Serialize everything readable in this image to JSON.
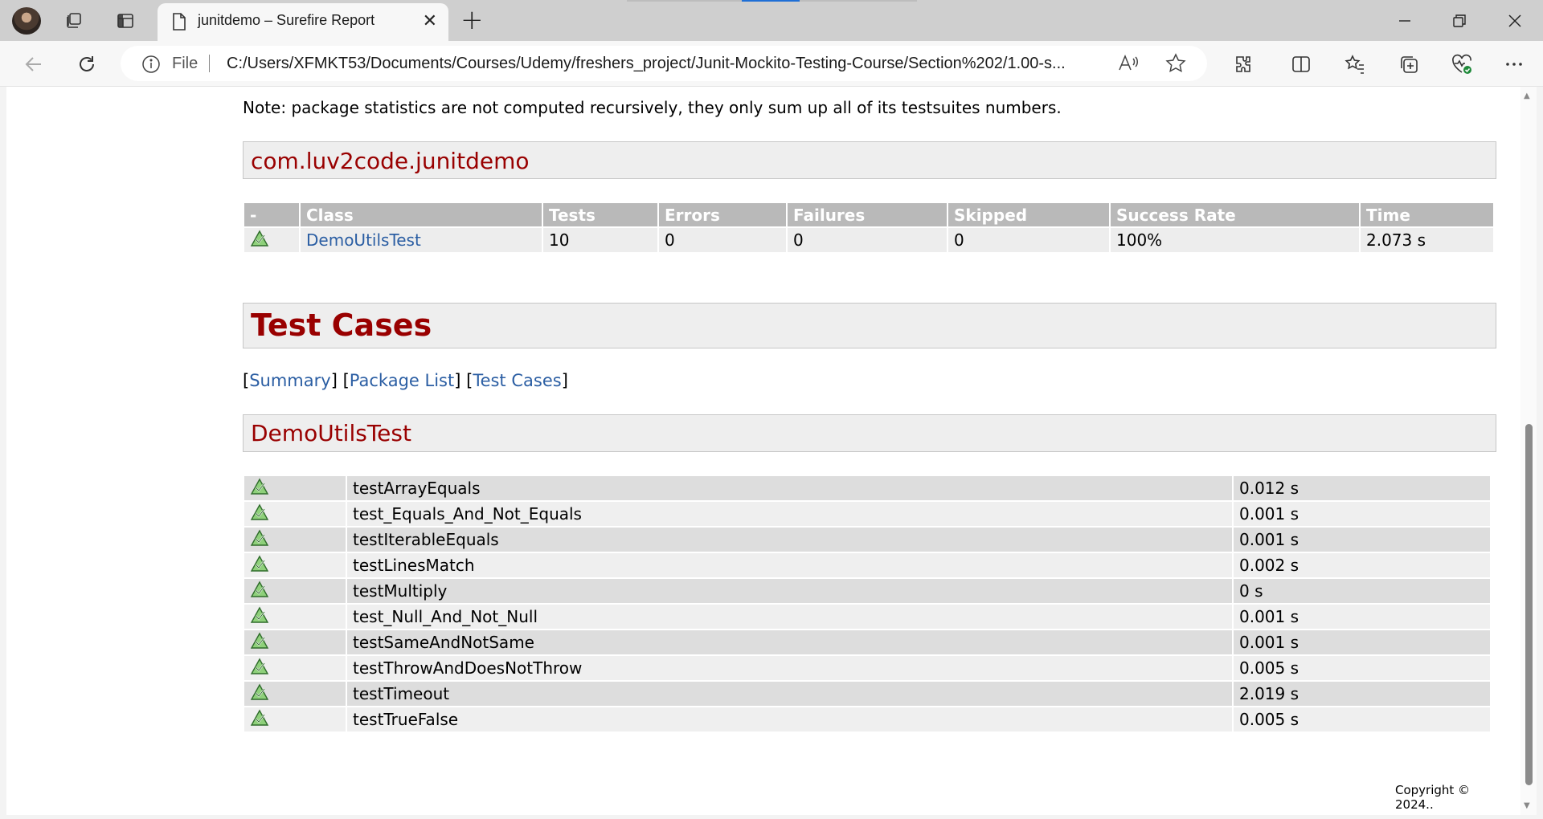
{
  "browser": {
    "tab": {
      "title": "junitdemo – Surefire Report"
    },
    "address": {
      "scheme": "File",
      "url": "C:/Users/XFMKT53/Documents/Courses/Udemy/freshers_project/Junit-Mockito-Testing-Course/Section%202/1.00-s..."
    },
    "icons": [
      "profile-avatar",
      "workspaces-icon",
      "tab-actions-icon",
      "document-icon",
      "close-icon",
      "plus-icon",
      "minimize-icon",
      "restore-icon",
      "close-window-icon",
      "back-arrow-icon",
      "refresh-icon",
      "info-icon",
      "read-aloud-icon",
      "star-icon",
      "extensions-icon",
      "split-screen-icon",
      "favorites-icon",
      "collections-icon",
      "browser-essentials-icon",
      "more-icon"
    ]
  },
  "page": {
    "note": "Note: package statistics are not computed recursively, they only sum up all of its testsuites numbers.",
    "package": {
      "name": "com.luv2code.junitdemo",
      "headers": [
        "-",
        "Class",
        "Tests",
        "Errors",
        "Failures",
        "Skipped",
        "Success Rate",
        "Time"
      ],
      "rows": [
        {
          "class": "DemoUtilsTest",
          "tests": "10",
          "errors": "0",
          "failures": "0",
          "skipped": "0",
          "success_rate": "100%",
          "time": "2.073 s"
        }
      ]
    },
    "test_cases": {
      "heading": "Test Cases",
      "nav": {
        "open": "[",
        "close": "]",
        "summary": "Summary",
        "package_list": "Package List",
        "test_cases": "Test Cases"
      },
      "class_name": "DemoUtilsTest",
      "cases": [
        {
          "name": "testArrayEquals",
          "time": "0.012 s"
        },
        {
          "name": "test_Equals_And_Not_Equals",
          "time": "0.001 s"
        },
        {
          "name": "testIterableEquals",
          "time": "0.001 s"
        },
        {
          "name": "testLinesMatch",
          "time": "0.002 s"
        },
        {
          "name": "testMultiply",
          "time": "0 s"
        },
        {
          "name": "test_Null_And_Not_Null",
          "time": "0.001 s"
        },
        {
          "name": "testSameAndNotSame",
          "time": "0.001 s"
        },
        {
          "name": "testThrowAndDoesNotThrow",
          "time": "0.005 s"
        },
        {
          "name": "testTimeout",
          "time": "2.019 s"
        },
        {
          "name": "testTrueFalse",
          "time": "0.005 s"
        }
      ]
    },
    "copyright": "Copyright © 2024.."
  },
  "colors": {
    "heading_red": "#990000",
    "link_blue": "#2b5ea3",
    "header_gray": "#b9b9b9",
    "success_green": "#3f9a3f"
  }
}
